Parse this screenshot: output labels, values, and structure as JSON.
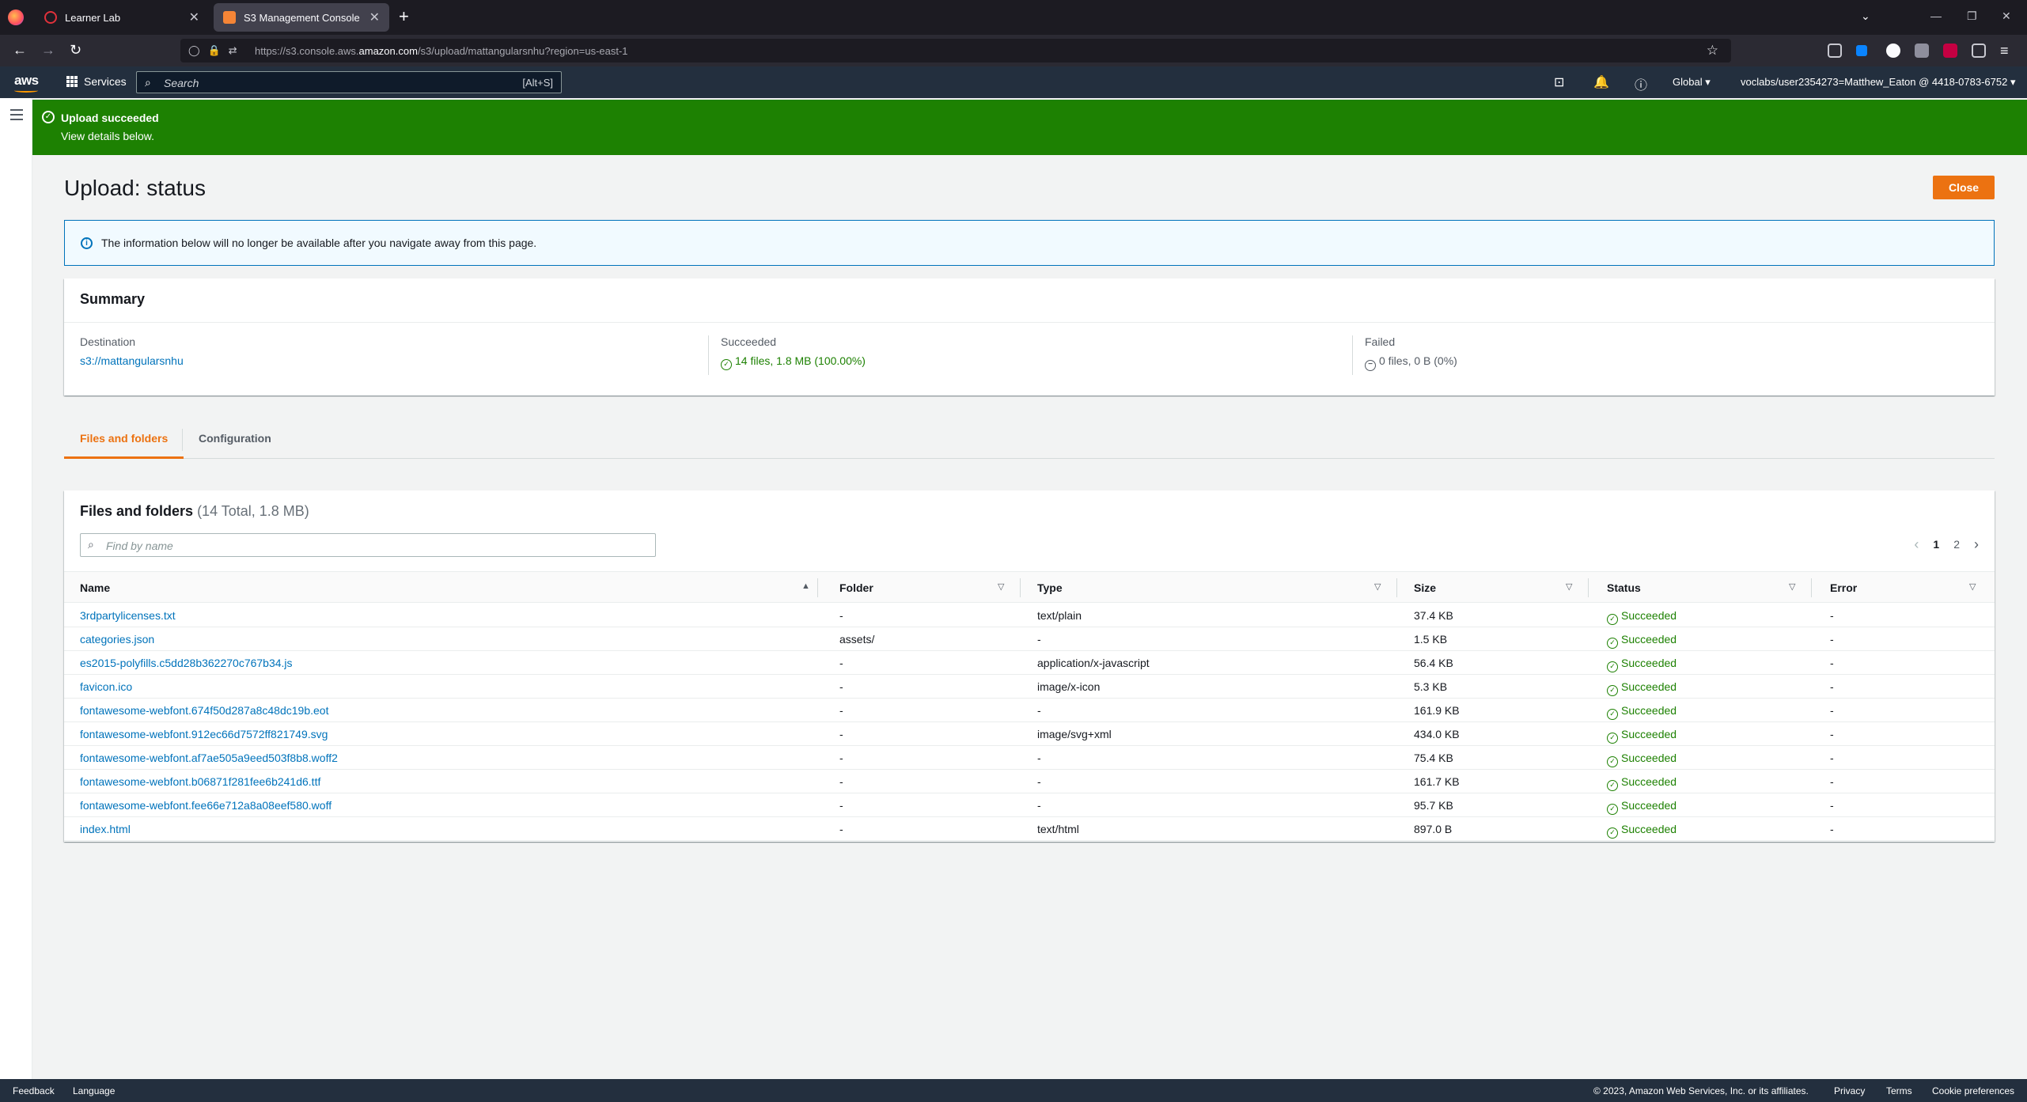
{
  "browser": {
    "tabs": [
      {
        "label": "Learner Lab"
      },
      {
        "label": "S3 Management Console"
      }
    ],
    "url_prefix": "https://s3.console.aws.",
    "url_domain": "amazon.com",
    "url_rest": "/s3/upload/mattangularsnhu?region=us-east-1"
  },
  "aws_header": {
    "logo": "aws",
    "services_label": "Services",
    "search_placeholder": "Search",
    "search_shortcut": "[Alt+S]",
    "region": "Global",
    "account": "voclabs/user2354273=Matthew_Eaton @ 4418-0783-6752"
  },
  "flash": {
    "title": "Upload succeeded",
    "subtitle": "View details below."
  },
  "page": {
    "title": "Upload: status",
    "close_label": "Close",
    "info_text": "The information below will no longer be available after you navigate away from this page."
  },
  "summary": {
    "heading": "Summary",
    "destination_label": "Destination",
    "destination_value": "s3://mattangularsnhu",
    "succeeded_label": "Succeeded",
    "succeeded_value": "14 files, 1.8 MB (100.00%)",
    "failed_label": "Failed",
    "failed_value": "0 files, 0 B (0%)"
  },
  "content_tabs": [
    {
      "label": "Files and folders"
    },
    {
      "label": "Configuration"
    }
  ],
  "files": {
    "heading": "Files and folders",
    "count": "(14 Total, 1.8 MB)",
    "find_placeholder": "Find by name",
    "pages": [
      "1",
      "2"
    ],
    "columns": {
      "name": "Name",
      "folder": "Folder",
      "type": "Type",
      "size": "Size",
      "status": "Status",
      "error": "Error"
    },
    "rows": [
      {
        "name": "3rdpartylicenses.txt",
        "folder": "-",
        "type": "text/plain",
        "size": "37.4 KB",
        "status": "Succeeded",
        "error": "-"
      },
      {
        "name": "categories.json",
        "folder": "assets/",
        "type": "-",
        "size": "1.5 KB",
        "status": "Succeeded",
        "error": "-"
      },
      {
        "name": "es2015-polyfills.c5dd28b362270c767b34.js",
        "folder": "-",
        "type": "application/x-javascript",
        "size": "56.4 KB",
        "status": "Succeeded",
        "error": "-"
      },
      {
        "name": "favicon.ico",
        "folder": "-",
        "type": "image/x-icon",
        "size": "5.3 KB",
        "status": "Succeeded",
        "error": "-"
      },
      {
        "name": "fontawesome-webfont.674f50d287a8c48dc19b.eot",
        "folder": "-",
        "type": "-",
        "size": "161.9 KB",
        "status": "Succeeded",
        "error": "-"
      },
      {
        "name": "fontawesome-webfont.912ec66d7572ff821749.svg",
        "folder": "-",
        "type": "image/svg+xml",
        "size": "434.0 KB",
        "status": "Succeeded",
        "error": "-"
      },
      {
        "name": "fontawesome-webfont.af7ae505a9eed503f8b8.woff2",
        "folder": "-",
        "type": "-",
        "size": "75.4 KB",
        "status": "Succeeded",
        "error": "-"
      },
      {
        "name": "fontawesome-webfont.b06871f281fee6b241d6.ttf",
        "folder": "-",
        "type": "-",
        "size": "161.7 KB",
        "status": "Succeeded",
        "error": "-"
      },
      {
        "name": "fontawesome-webfont.fee66e712a8a08eef580.woff",
        "folder": "-",
        "type": "-",
        "size": "95.7 KB",
        "status": "Succeeded",
        "error": "-"
      },
      {
        "name": "index.html",
        "folder": "-",
        "type": "text/html",
        "size": "897.0 B",
        "status": "Succeeded",
        "error": "-"
      }
    ]
  },
  "footer": {
    "feedback": "Feedback",
    "language": "Language",
    "copyright": "© 2023, Amazon Web Services, Inc. or its affiliates.",
    "privacy": "Privacy",
    "terms": "Terms",
    "cookies": "Cookie preferences"
  },
  "colors": {
    "aws_nav": "#232f3e",
    "success": "#1d8102",
    "accent": "#ec7211",
    "link": "#0073bb"
  }
}
